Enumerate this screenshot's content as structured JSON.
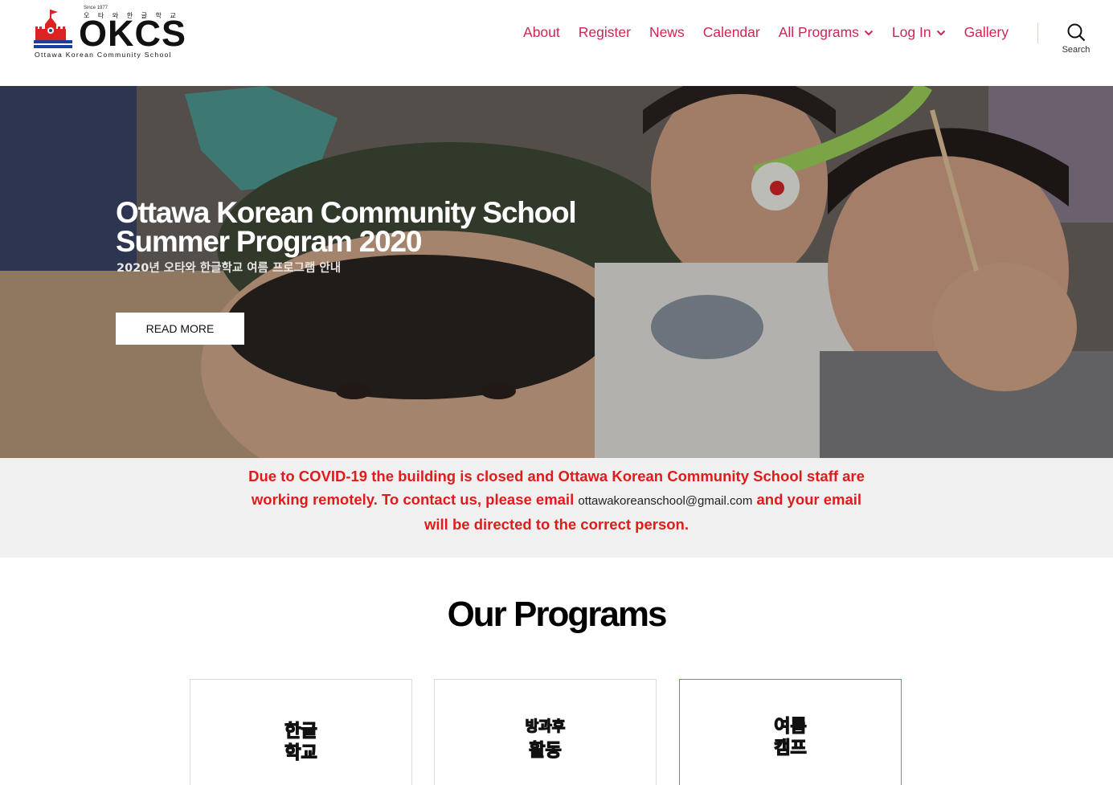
{
  "header": {
    "logo": {
      "since": "Since 1977",
      "korean": "오 타 와   한 글 학 교",
      "name": "OKCS",
      "subtitle": "Ottawa Korean Community School"
    },
    "nav": [
      {
        "label": "About"
      },
      {
        "label": "Register"
      },
      {
        "label": "News"
      },
      {
        "label": "Calendar"
      },
      {
        "label": "All Programs",
        "has_dropdown": true
      },
      {
        "label": "Log In",
        "has_dropdown": true
      },
      {
        "label": "Gallery"
      }
    ],
    "search_label": "Search",
    "accent_color": "#cd2653"
  },
  "hero": {
    "title": "Ottawa Korean Community School Summer Program 2020",
    "subtitle": "2020년 오타와 한글학교 여름 프로그램 안내",
    "button": "READ MORE"
  },
  "notice": {
    "text_before": "Due to COVID-19 the building is closed and Ottawa Korean Community School staff are working remotely. To contact us, please email ",
    "email": "ottawakoreanschool@gmail.com",
    "text_after": " and your email will be directed to the correct person.",
    "color": "#e11b1b"
  },
  "programs": {
    "title": "Our Programs",
    "cards": [
      {
        "line1": "한글",
        "line2": "학교"
      },
      {
        "line1": "방과후",
        "line2": "활동"
      },
      {
        "line1": "여름",
        "line2": "캠프"
      }
    ]
  }
}
